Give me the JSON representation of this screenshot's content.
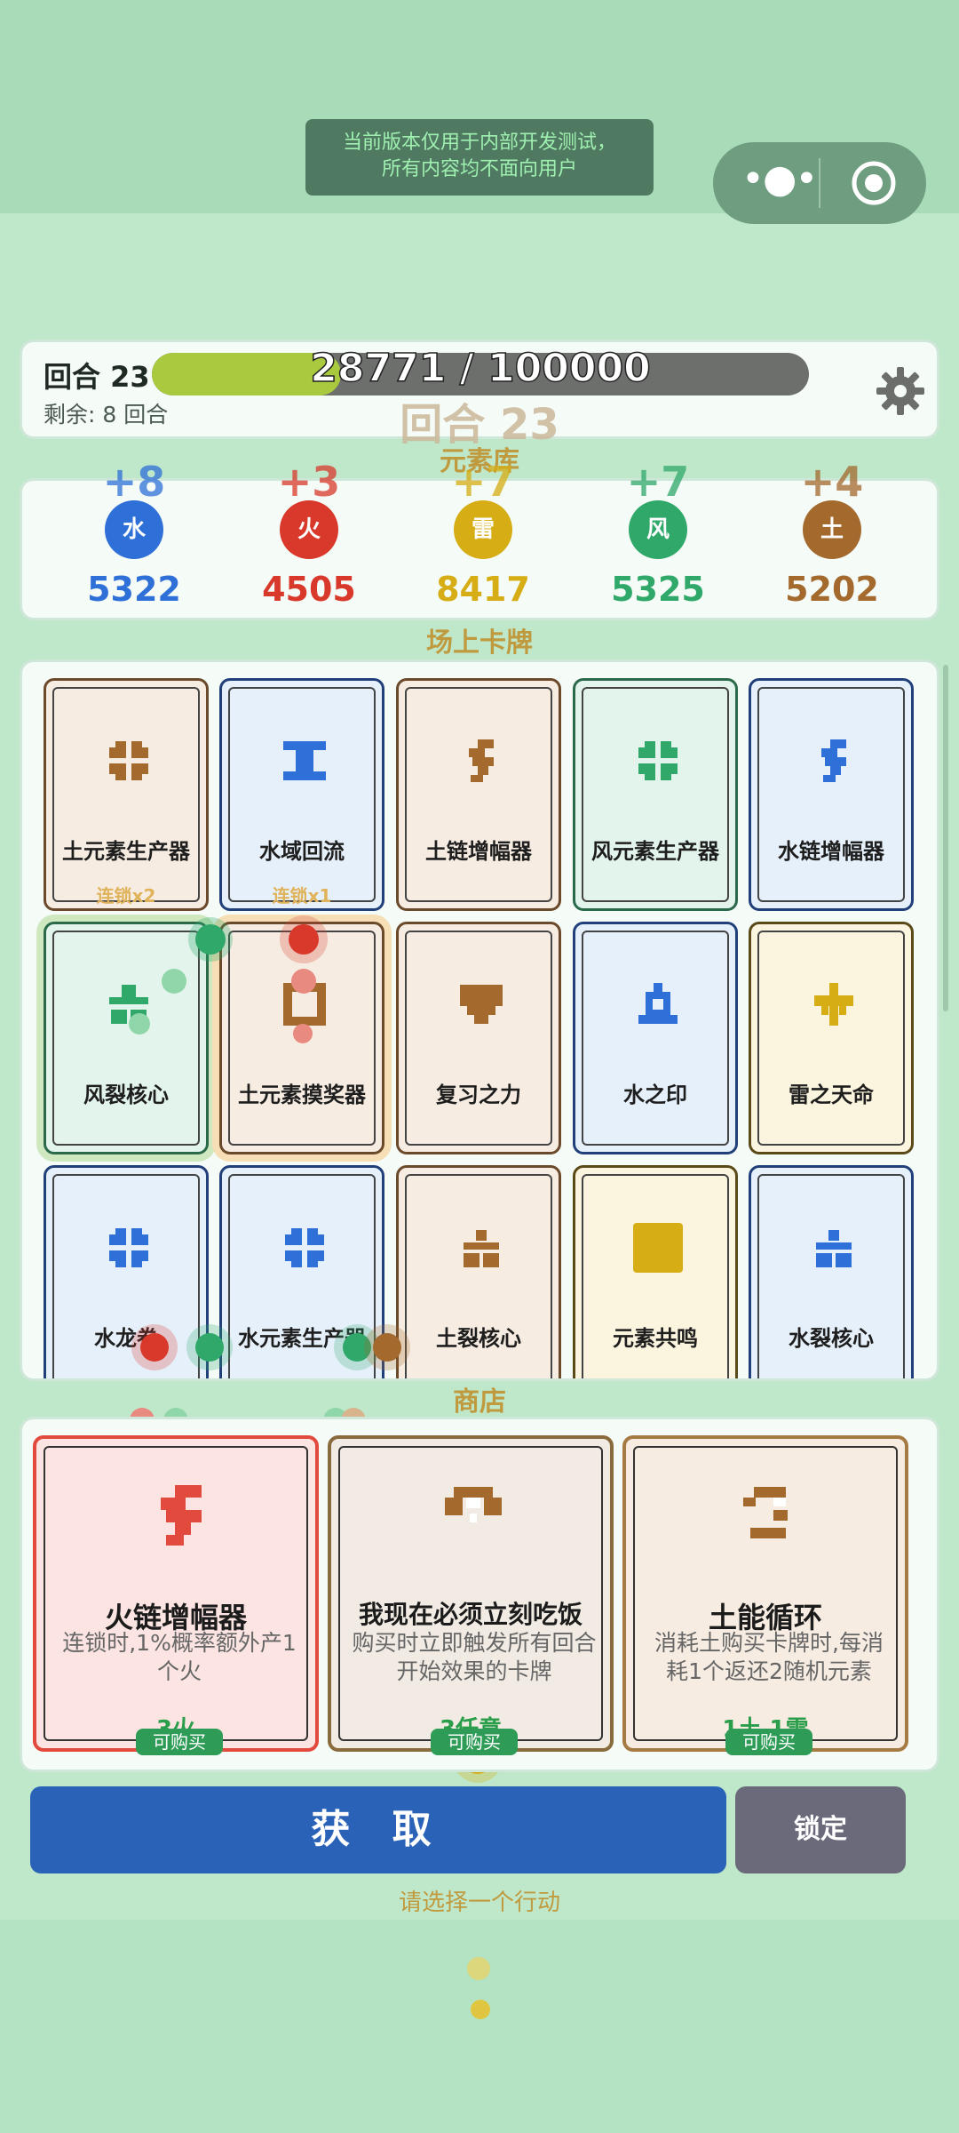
{
  "notice": {
    "line1": "当前版本仅用于内部开发测试，",
    "line2": "所有内容均不面向用户"
  },
  "capsule": {
    "more_icon": "more-dots-icon",
    "close_icon": "target-icon"
  },
  "header": {
    "round_label": "回合 23",
    "remaining": "剩余: 8 回合",
    "progress_text": "28771 / 100000",
    "progress_value": 28771,
    "progress_max": 100000,
    "ghost_round": "回合 23",
    "settings_icon": "gear-icon"
  },
  "sections": {
    "elements": "元素库",
    "board": "场上卡牌",
    "shop": "商店"
  },
  "elements": [
    {
      "label": "水",
      "delta": "+8",
      "count": "5322",
      "color": "#2e6fd8"
    },
    {
      "label": "火",
      "delta": "+3",
      "count": "4505",
      "color": "#d9392b"
    },
    {
      "label": "雷",
      "delta": "+7",
      "count": "8417",
      "color": "#d6ad14"
    },
    {
      "label": "风",
      "delta": "+7",
      "count": "5325",
      "color": "#2fa86a"
    },
    {
      "label": "土",
      "delta": "+4",
      "count": "5202",
      "color": "#a3692d"
    }
  ],
  "board": {
    "cards": [
      {
        "name": "土元素生产器",
        "chain": "连锁x2",
        "kind": "earth",
        "icon": "earth-producer-icon"
      },
      {
        "name": "水域回流",
        "chain": "连锁x1",
        "kind": "water",
        "icon": "water-flow-icon"
      },
      {
        "name": "土链增幅器",
        "chain": "",
        "kind": "earth",
        "icon": "earth-amplifier-icon"
      },
      {
        "name": "风元素生产器",
        "chain": "",
        "kind": "wind",
        "icon": "wind-producer-icon"
      },
      {
        "name": "水链增幅器",
        "chain": "",
        "kind": "water",
        "icon": "water-amplifier-icon"
      },
      {
        "name": "风裂核心",
        "chain": "",
        "kind": "wind",
        "icon": "wind-core-icon"
      },
      {
        "name": "土元素摸奖器",
        "chain": "",
        "kind": "earth",
        "icon": "earth-lottery-icon"
      },
      {
        "name": "复习之力",
        "chain": "",
        "kind": "earth",
        "icon": "review-power-icon"
      },
      {
        "name": "水之印",
        "chain": "",
        "kind": "water",
        "icon": "water-seal-icon"
      },
      {
        "name": "雷之天命",
        "chain": "",
        "kind": "thunder",
        "icon": "thunder-fate-icon"
      },
      {
        "name": "水龙卷",
        "chain": "",
        "kind": "water",
        "icon": "water-tornado-icon"
      },
      {
        "name": "水元素生产器",
        "chain": "",
        "kind": "water",
        "icon": "water-producer-icon"
      },
      {
        "name": "土裂核心",
        "chain": "",
        "kind": "earth",
        "icon": "earth-core-icon"
      },
      {
        "name": "元素共鸣",
        "chain": "",
        "kind": "thunder",
        "icon": "resonance-icon"
      },
      {
        "name": "水裂核心",
        "chain": "",
        "kind": "water",
        "icon": "water-core-icon"
      }
    ]
  },
  "shop": {
    "items": [
      {
        "title": "火链增幅器",
        "desc": "连锁时,1%概率额外产1个火",
        "cost": "3火",
        "buy": "可购买",
        "kind": "fire",
        "icon": "fire-amplifier-icon"
      },
      {
        "title": "我现在必须立刻吃饭",
        "desc": "购买时立即触发所有回合开始效果的卡牌",
        "cost": "3任意",
        "buy": "可购买",
        "kind": "any",
        "icon": "eat-now-icon"
      },
      {
        "title": "土能循环",
        "desc": "消耗土购买卡牌时,每消耗1个返还2随机元素",
        "cost": "1土 1雷",
        "buy": "可购买",
        "kind": "earth",
        "icon": "earth-cycle-icon"
      }
    ]
  },
  "actions": {
    "get": "获 取",
    "lock": "锁定",
    "hint": "请选择一个行动"
  }
}
